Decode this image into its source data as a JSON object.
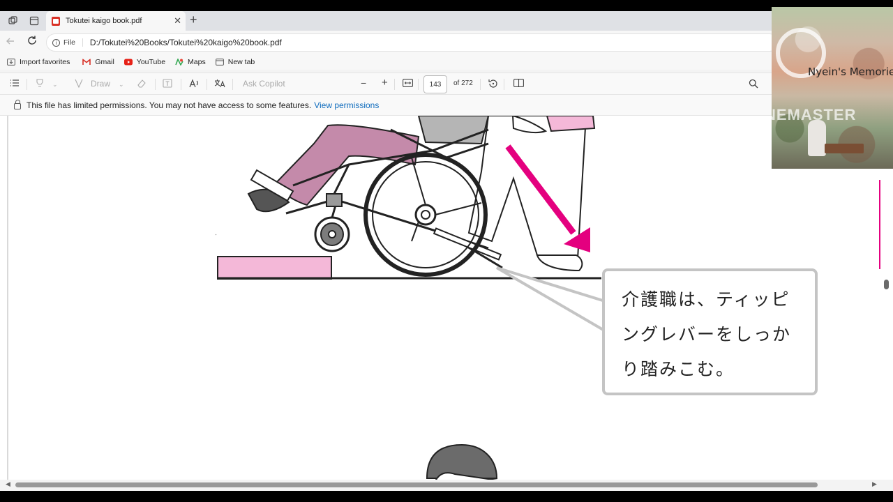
{
  "tab": {
    "title": "Tokutei kaigo book.pdf",
    "close": "✕",
    "new": "+"
  },
  "address": {
    "scheme": "File",
    "url": "D:/Tokutei%20Books/Tokutei%20kaigo%20book.pdf"
  },
  "favorites": [
    {
      "label": "Import favorites",
      "icon": "import-icon",
      "color": "#555555"
    },
    {
      "label": "Gmail",
      "icon": "gmail-icon",
      "color": "#d93025"
    },
    {
      "label": "YouTube",
      "icon": "youtube-icon",
      "color": "#e62117"
    },
    {
      "label": "Maps",
      "icon": "maps-icon",
      "color": "#34a853"
    },
    {
      "label": "New tab",
      "icon": "new-tab-icon",
      "color": "#555555"
    }
  ],
  "pdf_toolbar": {
    "draw": "Draw",
    "ask_copilot": "Ask Copilot",
    "zoom_out": "−",
    "zoom_in": "+",
    "page": "143",
    "page_of": "of 272"
  },
  "permission_bar": {
    "message": "This file has limited permissions. You may not have access to some features.",
    "link": "View permissions"
  },
  "bubble_lines": [
    "介護職は、ティッピ",
    "ングレバーをしっか",
    "り踏みこむ。"
  ],
  "overlay": {
    "title": "Nyein's Memories",
    "brand": "KINEMASTER"
  },
  "colors": {
    "accent": "#e4007f",
    "link": "#0f6cbd",
    "pink_fill": "#f4b8d8",
    "trousers": "#c48aaa"
  }
}
